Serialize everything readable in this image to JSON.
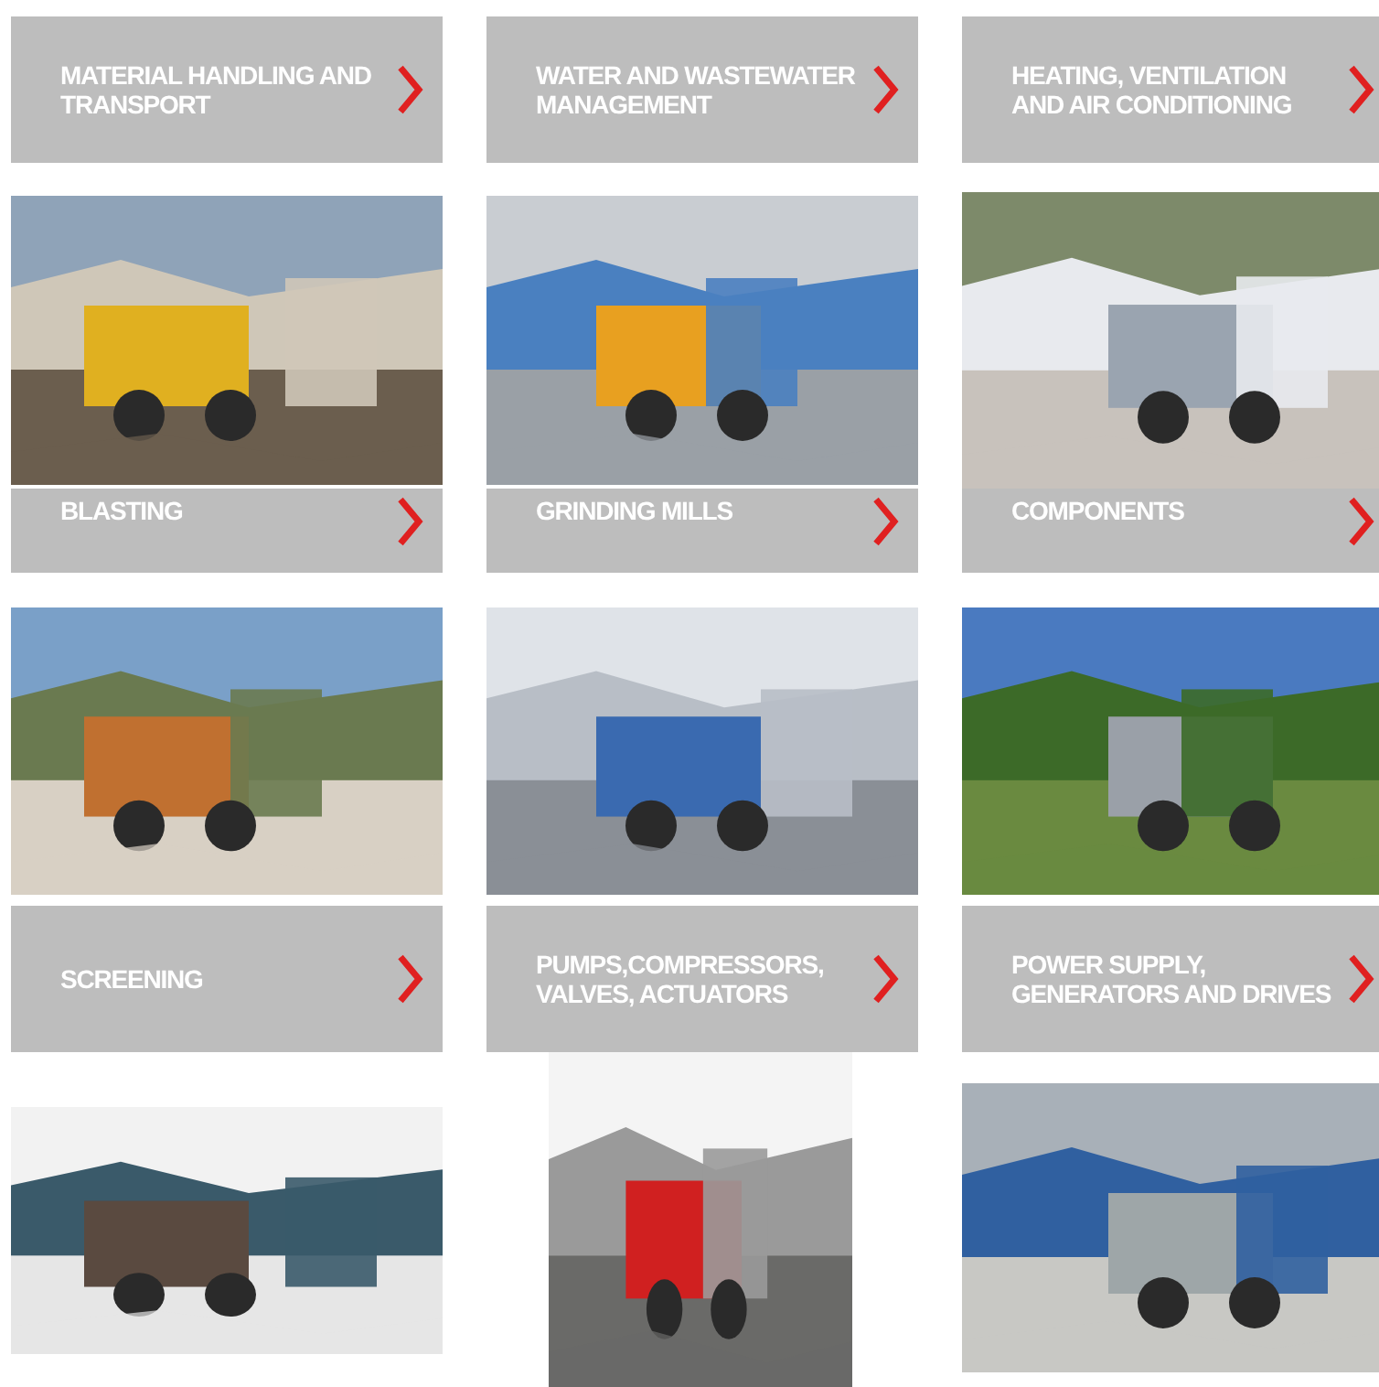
{
  "categories": [
    {
      "title": "MATERIAL HANDLING AND TRANSPORT"
    },
    {
      "title": "WATER AND WASTEWATER MANAGEMENT"
    },
    {
      "title": "HEATING, VENTILATION AND AIR CONDITIONING"
    },
    {
      "title": "BLASTING"
    },
    {
      "title": "GRINDING MILLS"
    },
    {
      "title": "COMPONENTS"
    },
    {
      "title": "SCREENING"
    },
    {
      "title": "PUMPS,COMPRESSORS, VALVES, ACTUATORS"
    },
    {
      "title": "POWER SUPPLY, GENERATORS AND DRIVES"
    }
  ]
}
